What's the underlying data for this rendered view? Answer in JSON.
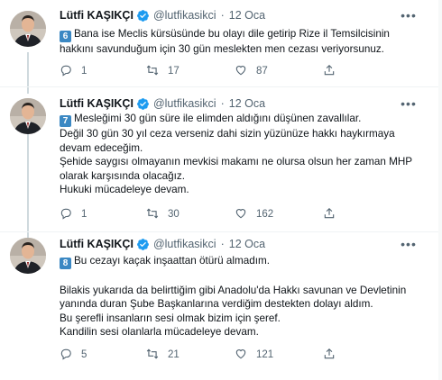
{
  "author": {
    "name": "Lütfi KAŞIKÇI",
    "handle": "@lutfikasikci",
    "verified_color": "#1d9bf0"
  },
  "tweets": [
    {
      "date": "12 Oca",
      "badge": "6",
      "lines": [
        "Bana ise Meclis kürsüsünde bu olayı dile getirip Rize il Temsilcisinin",
        "hakkını savunduğum için 30 gün meslekten men cezası veriyorsunuz."
      ],
      "replies": "1",
      "retweets": "17",
      "likes": "87"
    },
    {
      "date": "12 Oca",
      "badge": "7",
      "lines": [
        "Mesleğimi 30 gün süre ile elimden aldığını düşünen zavallılar.",
        "Değil 30 gün 30 yıl ceza verseniz dahi sizin yüzünüze hakkı haykırmaya",
        "devam edeceğim.",
        "Şehide saygısı olmayanın mevkisi makamı ne olursa olsun her zaman MHP",
        "olarak karşısında olacağız.",
        "Hukuki mücadeleye devam."
      ],
      "replies": "1",
      "retweets": "30",
      "likes": "162"
    },
    {
      "date": "12 Oca",
      "badge": "8",
      "lines": [
        "Bu cezayı kaçak inşaattan ötürü almadım.",
        "",
        "Bilakis yukarıda da belirttiğim gibi Anadolu'da Hakkı savunan ve Devletinin",
        "yanında duran Şube Başkanlarına verdiğim destekten dolayı aldım.",
        "Bu şerefli insanların sesi olmak bizim için şeref.",
        "Kandilin sesi olanlarla mücadeleye devam."
      ],
      "replies": "5",
      "retweets": "21",
      "likes": "121"
    }
  ],
  "colors": {
    "text": "#0f1419",
    "secondary": "#536471",
    "badge": "#3b88c3",
    "divider": "#eff3f4"
  },
  "icons": [
    "verified-icon",
    "more-icon",
    "reply-icon",
    "retweet-icon",
    "like-icon",
    "share-icon"
  ]
}
